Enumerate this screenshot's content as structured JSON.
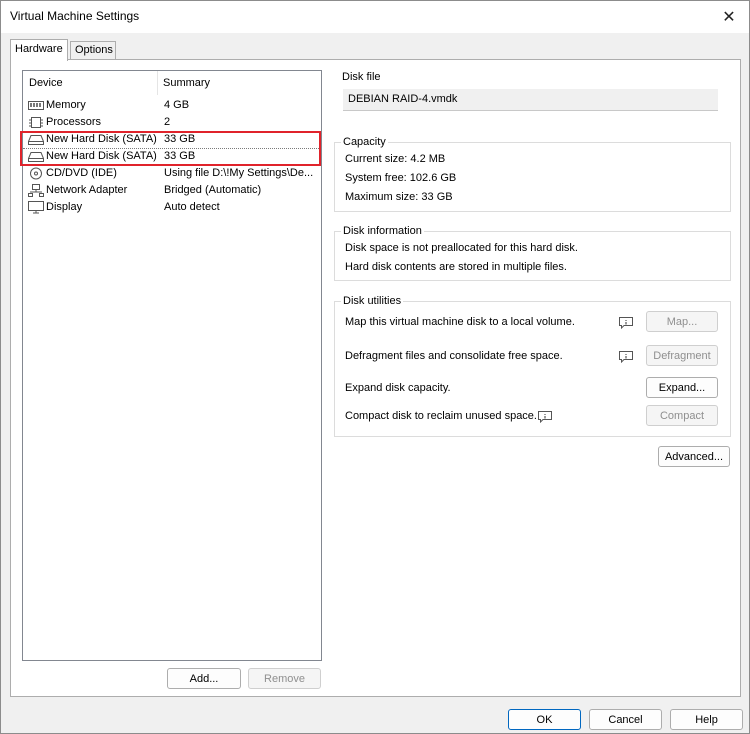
{
  "window": {
    "title": "Virtual Machine Settings",
    "close_glyph": "✕"
  },
  "tabs": [
    {
      "label": "Hardware",
      "active": true
    },
    {
      "label": "Options",
      "active": false
    }
  ],
  "device_list": {
    "headers": {
      "device": "Device",
      "summary": "Summary"
    },
    "rows": [
      {
        "icon": "memory-icon",
        "name": "Memory",
        "summary": "4 GB"
      },
      {
        "icon": "processor-icon",
        "name": "Processors",
        "summary": "2"
      },
      {
        "icon": "hard-disk-icon",
        "name": "New Hard Disk (SATA)",
        "summary": "33 GB"
      },
      {
        "icon": "hard-disk-icon",
        "name": "New Hard Disk (SATA)",
        "summary": "33 GB"
      },
      {
        "icon": "cd-dvd-icon",
        "name": "CD/DVD (IDE)",
        "summary": "Using file D:\\!My Settings\\De..."
      },
      {
        "icon": "network-adapter-icon",
        "name": "Network Adapter",
        "summary": "Bridged (Automatic)"
      },
      {
        "icon": "display-icon",
        "name": "Display",
        "summary": "Auto detect"
      }
    ],
    "add_label": "Add...",
    "remove_label": "Remove"
  },
  "disk_file": {
    "title": "Disk file",
    "value": "DEBIAN RAID-4.vmdk"
  },
  "capacity": {
    "title": "Capacity",
    "current": "Current size:  4.2 MB",
    "system_free": "System free:  102.6 GB",
    "maximum": "Maximum size:  33 GB"
  },
  "disk_information": {
    "title": "Disk information",
    "line1": "Disk space is not preallocated for this hard disk.",
    "line2": "Hard disk contents are stored in multiple files."
  },
  "disk_utilities": {
    "title": "Disk utilities",
    "map_text": "Map this virtual machine disk to a local volume.",
    "map_button": "Map...",
    "defrag_text": "Defragment files and consolidate free space.",
    "defrag_button": "Defragment",
    "expand_text": "Expand disk capacity.",
    "expand_button": "Expand...",
    "compact_text": "Compact disk to reclaim unused space.",
    "compact_button": "Compact"
  },
  "advanced_button": "Advanced...",
  "footer": {
    "ok": "OK",
    "cancel": "Cancel",
    "help": "Help"
  },
  "colors": {
    "highlight": "#e0232b",
    "accent": "#0067c0"
  }
}
